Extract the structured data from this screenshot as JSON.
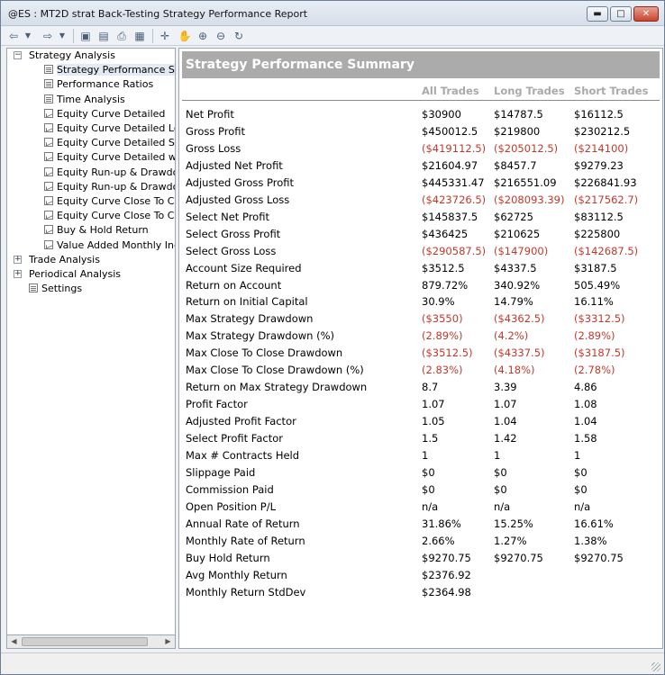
{
  "window": {
    "title": "@ES : MT2D strat Back-Testing Strategy Performance Report",
    "controls": {
      "minimize": "▬",
      "maximize": "□",
      "close": "✕"
    }
  },
  "toolbar": {
    "icons": [
      "back-icon",
      "dropdown-icon",
      "forward-icon",
      "dropdown-icon",
      "save-icon",
      "page-setup-icon",
      "print-icon",
      "view-icon",
      "crosshair-icon",
      "hand-icon",
      "zoom-in-icon",
      "zoom-out-icon",
      "refresh-icon"
    ]
  },
  "tree": {
    "items": [
      {
        "label": "Strategy Analysis",
        "level": 0,
        "expander": "−",
        "icon": "",
        "selected": false
      },
      {
        "label": "Strategy Performance Summary",
        "level": 1,
        "icon": "report",
        "selected": true
      },
      {
        "label": "Performance Ratios",
        "level": 1,
        "icon": "report",
        "selected": false
      },
      {
        "label": "Time Analysis",
        "level": 1,
        "icon": "report",
        "selected": false
      },
      {
        "label": "Equity Curve Detailed",
        "level": 1,
        "icon": "graph",
        "selected": false
      },
      {
        "label": "Equity Curve Detailed Long",
        "level": 1,
        "icon": "graph",
        "selected": false
      },
      {
        "label": "Equity Curve Detailed Short",
        "level": 1,
        "icon": "graph",
        "selected": false
      },
      {
        "label": "Equity Curve Detailed with",
        "level": 1,
        "icon": "graph",
        "selected": false
      },
      {
        "label": "Equity Run-up & Drawdow",
        "level": 1,
        "icon": "graph",
        "selected": false
      },
      {
        "label": "Equity Run-up & Drawdow",
        "level": 1,
        "icon": "graph",
        "selected": false
      },
      {
        "label": "Equity Curve Close To Clos",
        "level": 1,
        "icon": "graph",
        "selected": false
      },
      {
        "label": "Equity Curve Close To Clos",
        "level": 1,
        "icon": "graph",
        "selected": false
      },
      {
        "label": "Buy & Hold Return",
        "level": 1,
        "icon": "graph",
        "selected": false
      },
      {
        "label": "Value Added Monthly Index",
        "level": 1,
        "icon": "graph",
        "selected": false
      },
      {
        "label": "Trade Analysis",
        "level": 0,
        "expander": "+",
        "icon": "",
        "selected": false
      },
      {
        "label": "Periodical Analysis",
        "level": 0,
        "expander": "+",
        "icon": "",
        "selected": false
      },
      {
        "label": "Settings",
        "level": 0,
        "expander": "",
        "icon": "report",
        "selected": false
      }
    ]
  },
  "report": {
    "title": "Strategy Performance Summary",
    "columns": [
      "All Trades",
      "Long Trades",
      "Short Trades"
    ],
    "rows": [
      {
        "label": "Net Profit",
        "all": "$30900",
        "long": "$14787.5",
        "short": "$16112.5"
      },
      {
        "label": "Gross Profit",
        "all": "$450012.5",
        "long": "$219800",
        "short": "$230212.5"
      },
      {
        "label": "Gross Loss",
        "all": "($419112.5)",
        "long": "($205012.5)",
        "short": "($214100)"
      },
      {
        "label": "Adjusted Net Profit",
        "all": "$21604.97",
        "long": "$8457.7",
        "short": "$9279.23"
      },
      {
        "label": "Adjusted Gross Profit",
        "all": "$445331.47",
        "long": "$216551.09",
        "short": "$226841.93"
      },
      {
        "label": "Adjusted Gross Loss",
        "all": "($423726.5)",
        "long": "($208093.39)",
        "short": "($217562.7)"
      },
      {
        "label": "Select Net Profit",
        "all": "$145837.5",
        "long": "$62725",
        "short": "$83112.5"
      },
      {
        "label": "Select Gross Profit",
        "all": "$436425",
        "long": "$210625",
        "short": "$225800"
      },
      {
        "label": "Select Gross Loss",
        "all": "($290587.5)",
        "long": "($147900)",
        "short": "($142687.5)"
      },
      {
        "label": "Account Size Required",
        "all": "$3512.5",
        "long": "$4337.5",
        "short": "$3187.5"
      },
      {
        "label": "Return on Account",
        "all": "879.72%",
        "long": "340.92%",
        "short": "505.49%"
      },
      {
        "label": "Return on Initial Capital",
        "all": "30.9%",
        "long": "14.79%",
        "short": "16.11%"
      },
      {
        "label": "Max Strategy Drawdown",
        "all": "($3550)",
        "long": "($4362.5)",
        "short": "($3312.5)"
      },
      {
        "label": "Max Strategy Drawdown (%)",
        "all": "(2.89%)",
        "long": "(4.2%)",
        "short": "(2.89%)"
      },
      {
        "label": "Max Close To Close Drawdown",
        "all": "($3512.5)",
        "long": "($4337.5)",
        "short": "($3187.5)"
      },
      {
        "label": "Max Close To Close Drawdown (%)",
        "all": "(2.83%)",
        "long": "(4.18%)",
        "short": "(2.78%)"
      },
      {
        "label": "Return on Max Strategy Drawdown",
        "all": "8.7",
        "long": "3.39",
        "short": "4.86"
      },
      {
        "label": "Profit Factor",
        "all": "1.07",
        "long": "1.07",
        "short": "1.08"
      },
      {
        "label": "Adjusted Profit Factor",
        "all": "1.05",
        "long": "1.04",
        "short": "1.04"
      },
      {
        "label": "Select Profit Factor",
        "all": "1.5",
        "long": "1.42",
        "short": "1.58"
      },
      {
        "label": "Max # Contracts Held",
        "all": "1",
        "long": "1",
        "short": "1"
      },
      {
        "label": "Slippage Paid",
        "all": "$0",
        "long": "$0",
        "short": "$0"
      },
      {
        "label": "Commission Paid",
        "all": "$0",
        "long": "$0",
        "short": "$0"
      },
      {
        "label": "Open Position P/L",
        "all": "n/a",
        "long": "n/a",
        "short": "n/a"
      },
      {
        "label": "Annual Rate of Return",
        "all": "31.86%",
        "long": "15.25%",
        "short": "16.61%"
      },
      {
        "label": "Monthly Rate of Return",
        "all": "2.66%",
        "long": "1.27%",
        "short": "1.38%"
      },
      {
        "label": "Buy  Hold Return",
        "all": "$9270.75",
        "long": "$9270.75",
        "short": "$9270.75"
      },
      {
        "label": "Avg Monthly Return",
        "all": "$2376.92",
        "long": "",
        "short": ""
      },
      {
        "label": "Monthly Return StdDev",
        "all": "$2364.98",
        "long": "",
        "short": ""
      }
    ]
  },
  "colors": {
    "negative": "#c0392b",
    "header_bg": "#ababab",
    "column_header": "#a9a9a9"
  }
}
